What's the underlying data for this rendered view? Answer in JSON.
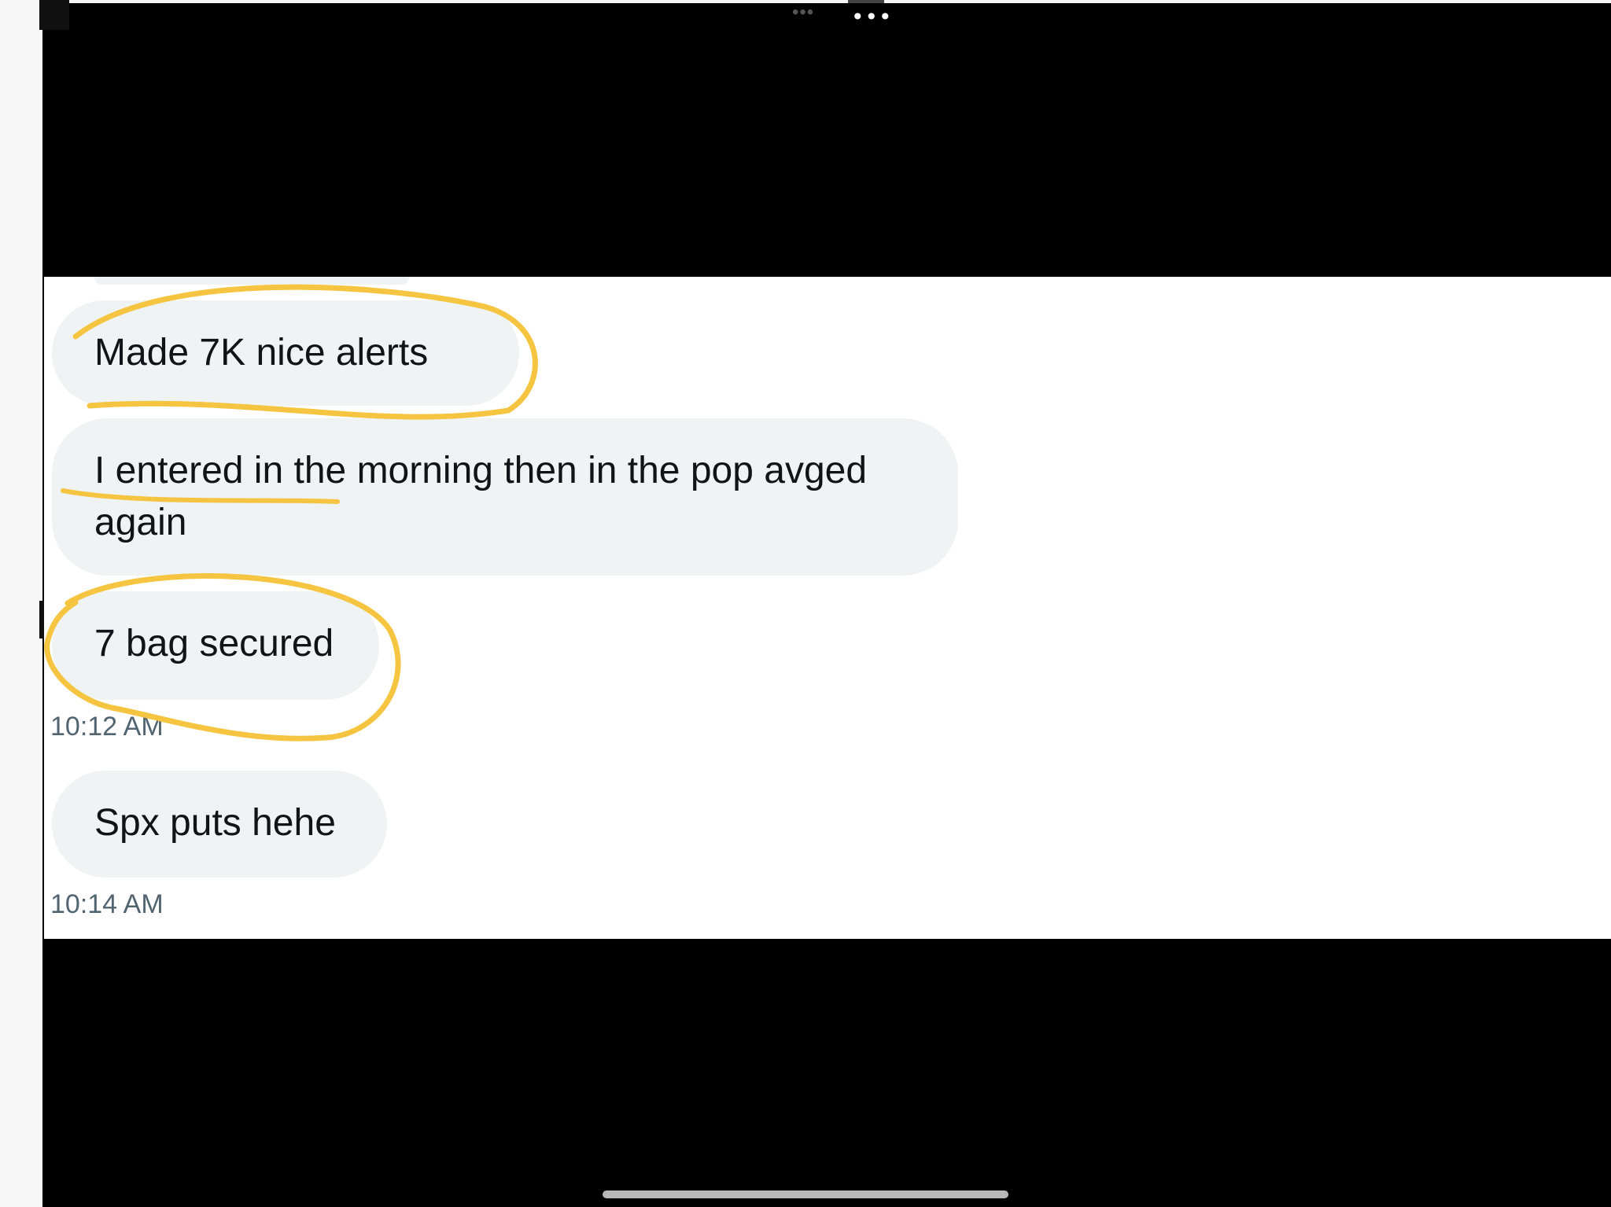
{
  "messages": [
    {
      "text": "Made 7K nice alerts"
    },
    {
      "text": "I entered in the morning then in the pop avged again"
    },
    {
      "text": "7 bag secured",
      "timestamp": "10:12 AM"
    },
    {
      "text": "Spx puts hehe",
      "timestamp": "10:14 AM"
    }
  ],
  "colors": {
    "bubble": "#eff3f4",
    "text": "#0f1419",
    "timestamp": "#536471",
    "highlight": "#f5c542"
  }
}
